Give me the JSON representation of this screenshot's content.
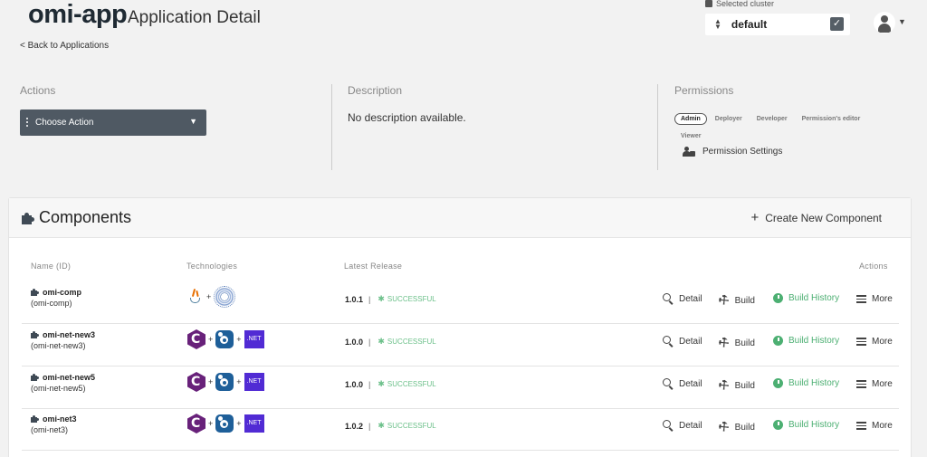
{
  "header": {
    "app_name": "omi-app",
    "subtitle": "Application Detail",
    "back_link": "< Back to Applications"
  },
  "cluster": {
    "label": "Selected cluster",
    "value": "default",
    "check_icon": "check-icon"
  },
  "user_menu": {
    "icon": "user-icon",
    "caret": "⌄"
  },
  "actions_panel": {
    "title": "Actions",
    "choose_action": "Choose Action"
  },
  "description_panel": {
    "title": "Description",
    "text": "No description available."
  },
  "permissions_panel": {
    "title": "Permissions",
    "roles": [
      "Admin",
      "Deployer",
      "Developer",
      "Permission's editor",
      "Viewer"
    ],
    "active_role": "Admin",
    "settings_label": "Permission Settings"
  },
  "components": {
    "title": "Components",
    "create_label": "Create New Component",
    "columns": {
      "name": "Name (ID)",
      "technologies": "Technologies",
      "latest_release": "Latest Release",
      "actions": "Actions"
    },
    "action_labels": {
      "detail": "Detail",
      "build": "Build",
      "build_history": "Build History",
      "more": "More"
    },
    "rows": [
      {
        "name": "omi-comp",
        "id": "(omi-comp)",
        "tech": [
          "java",
          "burst"
        ],
        "version": "1.0.1",
        "status": "SUCCESSFUL"
      },
      {
        "name": "omi-net-new3",
        "id": "(omi-net-new3)",
        "tech": [
          "csharp",
          "blue",
          "dotnet"
        ],
        "version": "1.0.0",
        "status": "SUCCESSFUL"
      },
      {
        "name": "omi-net-new5",
        "id": "(omi-net-new5)",
        "tech": [
          "csharp",
          "blue",
          "dotnet"
        ],
        "version": "1.0.0",
        "status": "SUCCESSFUL"
      },
      {
        "name": "omi-net3",
        "id": "(omi-net3)",
        "tech": [
          "csharp",
          "blue",
          "dotnet"
        ],
        "version": "1.0.2",
        "status": "SUCCESSFUL"
      }
    ],
    "tech_plus": "+",
    "dotnet_label": ".NET",
    "csharp_label": "C",
    "release_separator": "|",
    "status_glyph": "✱"
  },
  "colors": {
    "accent_green": "#4caf72",
    "status_green": "#6cc08a",
    "dark_button": "#4f5963"
  }
}
